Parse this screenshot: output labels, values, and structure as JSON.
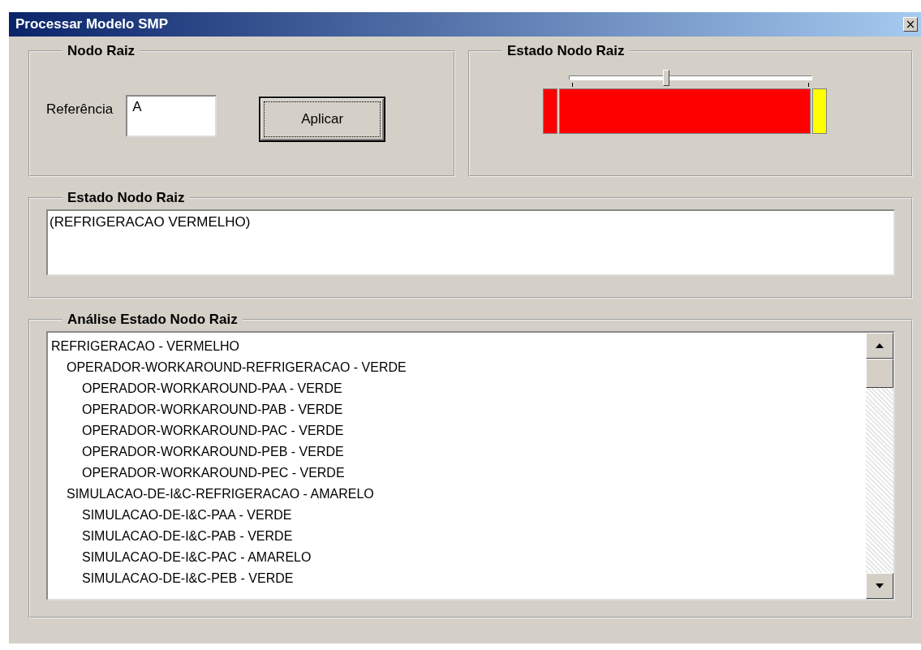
{
  "window": {
    "title": "Processar Modelo SMP",
    "close": "×"
  },
  "node_group": {
    "title": "Nodo Raiz",
    "label": "Referência",
    "value": "A",
    "button": "Aplicar"
  },
  "state_group": {
    "title": "Estado Nodo Raiz",
    "slider": {
      "level": 0.4
    },
    "segments": [
      {
        "kind": "narrow",
        "color": "#ff0000"
      },
      {
        "kind": "wide",
        "color": "#ff0000"
      },
      {
        "kind": "narrow",
        "color": "#ffff00"
      }
    ]
  },
  "state_text_group": {
    "title": "Estado Nodo Raiz",
    "value": "(REFRIGERACAO VERMELHO)"
  },
  "analysis_group": {
    "title": "Análise Estado Nodo Raiz",
    "tree": [
      {
        "text": "REFRIGERACAO - VERMELHO",
        "children": [
          {
            "text": "OPERADOR-WORKAROUND-REFRIGERACAO - VERDE",
            "children": [
              {
                "text": "OPERADOR-WORKAROUND-PAA - VERDE"
              },
              {
                "text": "OPERADOR-WORKAROUND-PAB - VERDE"
              },
              {
                "text": "OPERADOR-WORKAROUND-PAC - VERDE"
              },
              {
                "text": "OPERADOR-WORKAROUND-PEB - VERDE"
              },
              {
                "text": "OPERADOR-WORKAROUND-PEC - VERDE"
              }
            ]
          },
          {
            "text": "SIMULACAO-DE-I&C-REFRIGERACAO - AMARELO",
            "children": [
              {
                "text": "SIMULACAO-DE-I&C-PAA - VERDE"
              },
              {
                "text": "SIMULACAO-DE-I&C-PAB - VERDE"
              },
              {
                "text": "SIMULACAO-DE-I&C-PAC - AMARELO"
              },
              {
                "text": "SIMULACAO-DE-I&C-PEB - VERDE"
              }
            ]
          }
        ]
      }
    ]
  }
}
